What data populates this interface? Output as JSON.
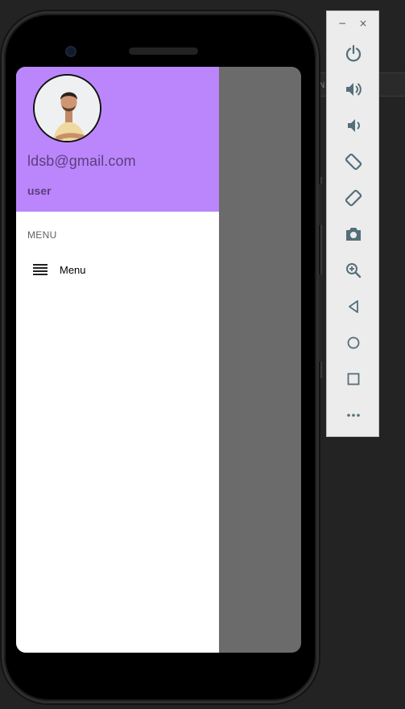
{
  "drawer": {
    "header": {
      "email": "ldsb@gmail.com",
      "role": "user"
    },
    "section_title": "MENU",
    "items": [
      {
        "label": "Menu",
        "icon": "menu-lines-icon"
      }
    ]
  },
  "emulator_toolbar": {
    "minimize_label": "−",
    "close_label": "×",
    "buttons": [
      {
        "name": "power-icon"
      },
      {
        "name": "volume-up-icon"
      },
      {
        "name": "volume-down-icon"
      },
      {
        "name": "rotate-left-icon"
      },
      {
        "name": "rotate-right-icon"
      },
      {
        "name": "camera-icon"
      },
      {
        "name": "zoom-icon"
      },
      {
        "name": "back-icon"
      },
      {
        "name": "home-icon"
      },
      {
        "name": "overview-icon"
      },
      {
        "name": "more-icon"
      }
    ]
  },
  "colors": {
    "header_bg": "#bb86fc",
    "scrim": "#6b6b6b",
    "toolbar_bg": "#ececec",
    "toolbar_icon": "#546e7a"
  }
}
